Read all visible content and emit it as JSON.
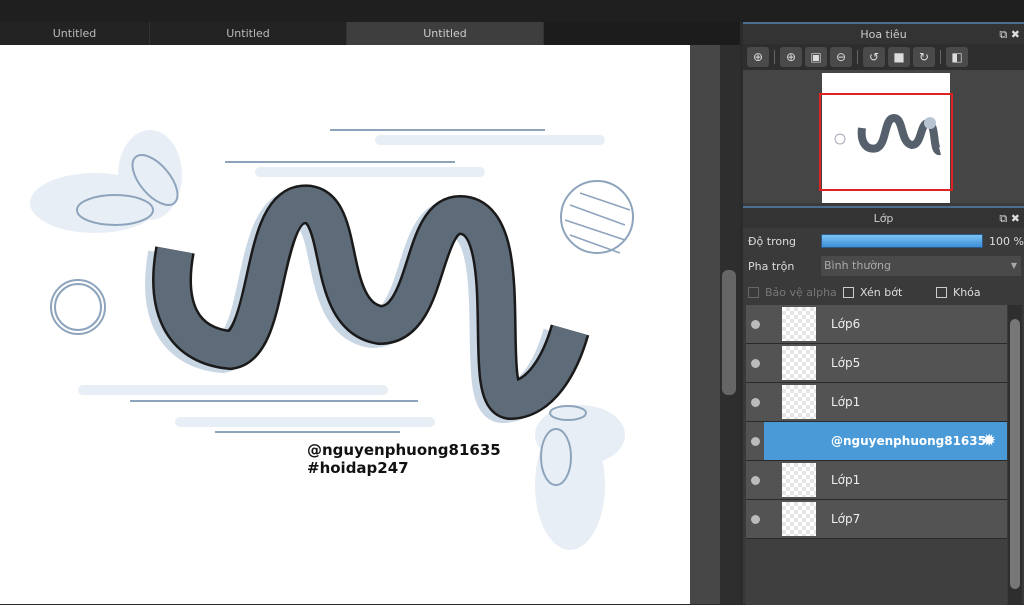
{
  "tabs": [
    {
      "label": "Untitled"
    },
    {
      "label": "Untitled"
    },
    {
      "label": "Untitled",
      "active": true
    }
  ],
  "canvas_text": {
    "handle": "@nguyenphuong81635",
    "hashtag": "#hoidap247"
  },
  "navigator": {
    "title": "Hoa tiêu",
    "tools": [
      "zoom-actual-icon",
      "zoom-in-icon",
      "fit-icon",
      "zoom-out-icon",
      "rotate-left-icon",
      "fullscreen-icon",
      "rotate-right-icon",
      "flip-icon"
    ]
  },
  "layers_panel": {
    "title": "Lớp",
    "opacity_label": "Độ trong",
    "opacity_value": "100 %",
    "opacity_fraction": 1.0,
    "blend_label": "Pha trộn",
    "blend_value": "Bình thường",
    "protect_alpha": "Bảo vệ alpha",
    "clip": "Xén bớt",
    "lock": "Khóa",
    "layers": [
      {
        "name": "Lớp6"
      },
      {
        "name": "Lớp5"
      },
      {
        "name": "Lớp1"
      },
      {
        "name": "@nguyenphuong81635",
        "selected": true
      },
      {
        "name": "Lớp1"
      },
      {
        "name": "Lớp7"
      }
    ]
  },
  "colors": {
    "accent": "#4a9ad8",
    "navigator_frame": "#dd2222"
  }
}
